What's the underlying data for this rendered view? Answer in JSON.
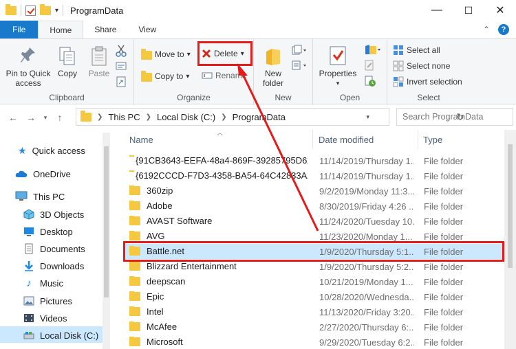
{
  "window": {
    "title": "ProgramData",
    "minimize": "—",
    "maximize": "☐",
    "close": "✕"
  },
  "tabs": {
    "file": "File",
    "home": "Home",
    "share": "Share",
    "view": "View",
    "chevron": "⌃"
  },
  "ribbon": {
    "clipboard": {
      "pin": "Pin to Quick access",
      "copy": "Copy",
      "paste": "Paste",
      "label": "Clipboard"
    },
    "organize": {
      "move_to": "Move to",
      "copy_to": "Copy to",
      "delete": "Delete",
      "rename": "Rename",
      "label": "Organize"
    },
    "new": {
      "new_folder": "New folder",
      "label": "New"
    },
    "open": {
      "properties": "Properties",
      "label": "Open"
    },
    "select": {
      "select_all": "Select all",
      "select_none": "Select none",
      "invert": "Invert selection",
      "label": "Select"
    }
  },
  "address": {
    "crumbs": [
      "This PC",
      "Local Disk (C:)",
      "ProgramData"
    ],
    "search_placeholder": "Search ProgramData"
  },
  "nav": {
    "items": [
      {
        "label": "Quick access",
        "icon": "star-icon"
      },
      {
        "label": "OneDrive",
        "icon": "cloud-icon"
      },
      {
        "label": "This PC",
        "icon": "pc-icon"
      },
      {
        "label": "3D Objects",
        "icon": "cube-icon"
      },
      {
        "label": "Desktop",
        "icon": "desktop-icon"
      },
      {
        "label": "Documents",
        "icon": "document-icon"
      },
      {
        "label": "Downloads",
        "icon": "download-icon"
      },
      {
        "label": "Music",
        "icon": "music-icon"
      },
      {
        "label": "Pictures",
        "icon": "picture-icon"
      },
      {
        "label": "Videos",
        "icon": "video-icon"
      },
      {
        "label": "Local Disk (C:)",
        "icon": "drive-icon"
      }
    ]
  },
  "list": {
    "headers": {
      "name": "Name",
      "date": "Date modified",
      "type": "Type"
    },
    "rows": [
      {
        "name": "{91CB3643-EEFA-48a4-869F-39285795D61...",
        "date": "11/14/2019/Thursday 1...",
        "type": "File folder"
      },
      {
        "name": "{6192CCCD-F7D3-4358-BA54-64C42833A...",
        "date": "11/14/2019/Thursday 1...",
        "type": "File folder"
      },
      {
        "name": "360zip",
        "date": "9/2/2019/Monday 11:3...",
        "type": "File folder"
      },
      {
        "name": "Adobe",
        "date": "8/30/2019/Friday 4:26 ...",
        "type": "File folder"
      },
      {
        "name": "AVAST Software",
        "date": "11/24/2020/Tuesday 10...",
        "type": "File folder"
      },
      {
        "name": "AVG",
        "date": "11/23/2020/Monday 1...",
        "type": "File folder"
      },
      {
        "name": "Battle.net",
        "date": "1/9/2020/Thursday 5:1...",
        "type": "File folder"
      },
      {
        "name": "Blizzard Entertainment",
        "date": "1/9/2020/Thursday 5:2...",
        "type": "File folder"
      },
      {
        "name": "deepscan",
        "date": "10/21/2019/Monday 1...",
        "type": "File folder"
      },
      {
        "name": "Epic",
        "date": "10/28/2020/Wednesda...",
        "type": "File folder"
      },
      {
        "name": "Intel",
        "date": "11/13/2020/Friday 3:20...",
        "type": "File folder"
      },
      {
        "name": "McAfee",
        "date": "2/27/2020/Thursday 6:...",
        "type": "File folder"
      },
      {
        "name": "Microsoft",
        "date": "9/29/2020/Tuesday 6:2...",
        "type": "File folder"
      }
    ]
  },
  "colors": {
    "accent": "#1979ca",
    "selection": "#cce8ff",
    "annotation": "#e21b1b",
    "folder": "#f5c842"
  }
}
